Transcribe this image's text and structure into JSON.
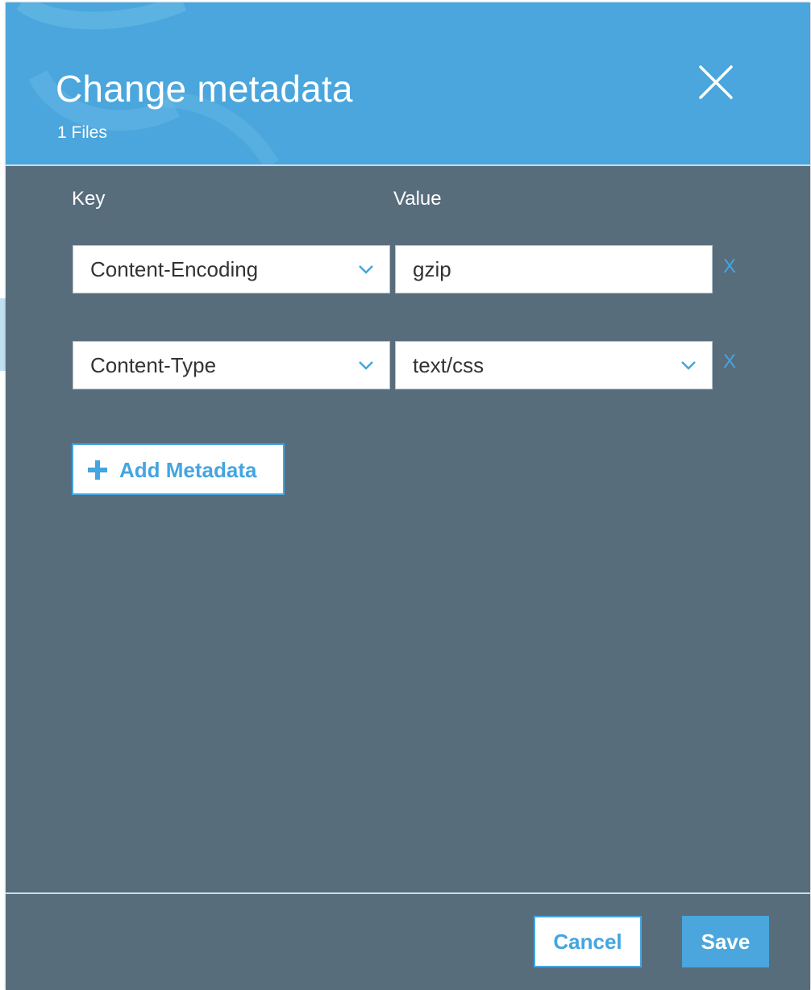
{
  "modal": {
    "title": "Change metadata",
    "subtitle": "1 Files",
    "close_icon": "close-icon"
  },
  "columns": {
    "key_label": "Key",
    "value_label": "Value"
  },
  "rows": [
    {
      "key": "Content-Encoding",
      "key_control": "dropdown",
      "value": "gzip",
      "value_control": "text-input",
      "remove_label": "X"
    },
    {
      "key": "Content-Type",
      "key_control": "dropdown",
      "value": "text/css",
      "value_control": "dropdown",
      "remove_label": "X"
    }
  ],
  "add_button": {
    "label": "Add Metadata",
    "icon": "plus-icon"
  },
  "footer": {
    "cancel_label": "Cancel",
    "save_label": "Save"
  },
  "colors": {
    "header_blue": "#4aa6dc",
    "body_slate": "#586d7c",
    "accent_blue": "#44a5e0",
    "white": "#ffffff"
  }
}
